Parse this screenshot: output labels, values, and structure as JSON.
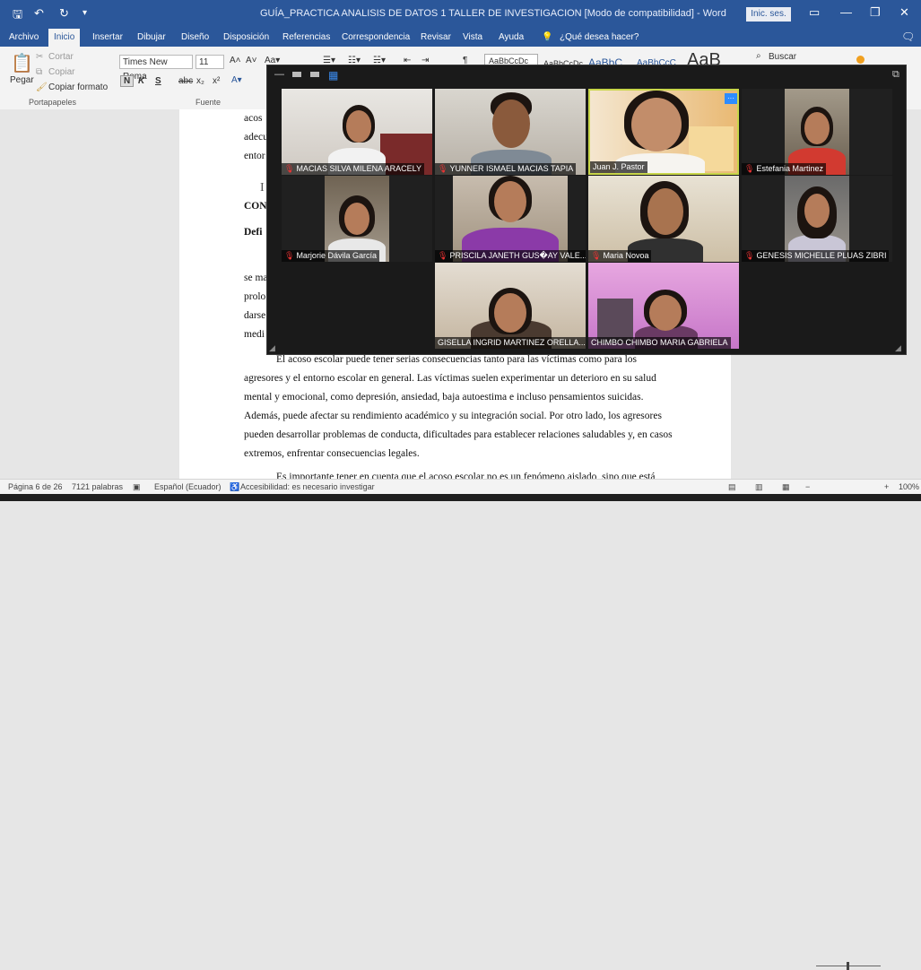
{
  "titlebar": {
    "title": "GUÍA_PRACTICA ANALISIS DE DATOS 1 TALLER DE INVESTIGACION [Modo de compatibilidad]  -  Word",
    "signin": "Inic. ses.",
    "icons": [
      "save-icon",
      "undo-icon",
      "redo-icon",
      "customize-icon",
      "ribbon-options-icon",
      "minimize-icon",
      "restore-icon",
      "close-icon"
    ]
  },
  "menu": {
    "tabs": [
      "Archivo",
      "Inicio",
      "Insertar",
      "Dibujar",
      "Diseño",
      "Disposición",
      "Referencias",
      "Correspondencia",
      "Revisar",
      "Vista",
      "Ayuda"
    ],
    "tell_me": "¿Qué desea hacer?"
  },
  "ribbon": {
    "paste": "Pegar",
    "cut": "Cortar",
    "copy": "Copiar",
    "format_painter": "Copiar formato",
    "clipboard_group": "Portapapeles",
    "font_name": "Times New Roma",
    "font_size": "11",
    "font_group": "Fuente",
    "bold": "N",
    "italic": "K",
    "underline": "S",
    "strike": "abc",
    "subscript": "x₂",
    "superscript": "x²",
    "search": "Buscar",
    "styles": [
      "AaBbCcDc",
      "AaBbCcDc",
      "AaBbC",
      "AaBbCcC",
      "AaB"
    ]
  },
  "document": {
    "partial_lines": [
      "acos",
      "adecu",
      "entor",
      "I",
      "CON",
      "Defi",
      "se ma",
      "prolo",
      "darse",
      "medi"
    ],
    "paragraph1": [
      "El acoso escolar puede tener serias consecuencias tanto para las víctimas como para los",
      "agresores y el entorno escolar en general. Las víctimas suelen experimentar un deterioro en su salud",
      "mental y emocional, como depresión, ansiedad, baja autoestima e incluso pensamientos suicidas.",
      "Además, puede afectar su rendimiento académico y su integración social. Por otro lado, los agresores",
      "pueden desarrollar problemas de conducta, dificultades para establecer relaciones saludables y, en casos",
      "extremos, enfrentar consecuencias legales."
    ],
    "paragraph2_partial": "Es importante tener en cuenta que el acoso escolar no es un fenómeno aislado, sino que está"
  },
  "statusbar": {
    "page": "Página 6 de 26",
    "words": "7121 palabras",
    "language": "Español (Ecuador)",
    "accessibility": "Accesibilidad: es necesario investigar",
    "zoom": "100%"
  },
  "meeting": {
    "participants": [
      {
        "name": "MACIAS SILVA MILENA ARACELY",
        "muted": true
      },
      {
        "name": "YUNNER ISMAEL MACIAS TAPIA",
        "muted": true
      },
      {
        "name": "Juan J. Pastor",
        "muted": false
      },
      {
        "name": "Estefania Martinez",
        "muted": true
      },
      {
        "name": "Marjorie Dávila García",
        "muted": true
      },
      {
        "name": "PRISCILA JANETH GUS�AY VALE...",
        "muted": true
      },
      {
        "name": "Maria Novoa",
        "muted": true
      },
      {
        "name": "GENESIS MICHELLE PLUAS ZIBRI",
        "muted": true
      },
      {
        "name": "GISELLA INGRID MARTINEZ ORELLA...",
        "muted": false
      },
      {
        "name": "CHIMBO CHIMBO MARIA GABRIELA",
        "muted": false
      }
    ],
    "colors": {
      "active_border": "#c8d64a",
      "muted": "#e33333",
      "window_bg": "#1a1a1a"
    }
  }
}
